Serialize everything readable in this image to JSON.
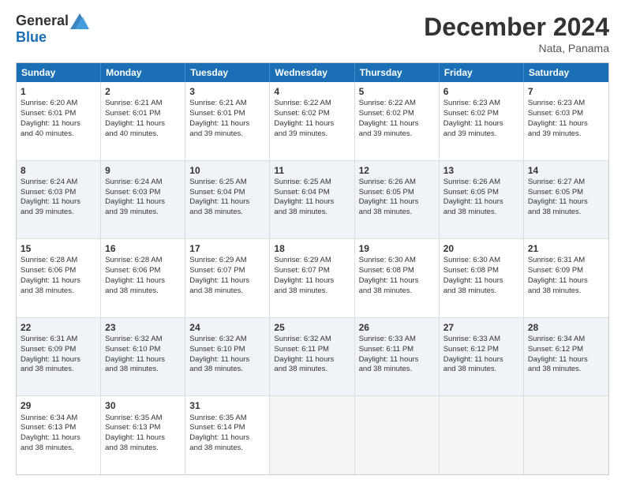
{
  "logo": {
    "general": "General",
    "blue": "Blue"
  },
  "title": "December 2024",
  "subtitle": "Nata, Panama",
  "header_days": [
    "Sunday",
    "Monday",
    "Tuesday",
    "Wednesday",
    "Thursday",
    "Friday",
    "Saturday"
  ],
  "weeks": [
    [
      {
        "day": "1",
        "lines": [
          "Sunrise: 6:20 AM",
          "Sunset: 6:01 PM",
          "Daylight: 11 hours",
          "and 40 minutes."
        ]
      },
      {
        "day": "2",
        "lines": [
          "Sunrise: 6:21 AM",
          "Sunset: 6:01 PM",
          "Daylight: 11 hours",
          "and 40 minutes."
        ]
      },
      {
        "day": "3",
        "lines": [
          "Sunrise: 6:21 AM",
          "Sunset: 6:01 PM",
          "Daylight: 11 hours",
          "and 39 minutes."
        ]
      },
      {
        "day": "4",
        "lines": [
          "Sunrise: 6:22 AM",
          "Sunset: 6:02 PM",
          "Daylight: 11 hours",
          "and 39 minutes."
        ]
      },
      {
        "day": "5",
        "lines": [
          "Sunrise: 6:22 AM",
          "Sunset: 6:02 PM",
          "Daylight: 11 hours",
          "and 39 minutes."
        ]
      },
      {
        "day": "6",
        "lines": [
          "Sunrise: 6:23 AM",
          "Sunset: 6:02 PM",
          "Daylight: 11 hours",
          "and 39 minutes."
        ]
      },
      {
        "day": "7",
        "lines": [
          "Sunrise: 6:23 AM",
          "Sunset: 6:03 PM",
          "Daylight: 11 hours",
          "and 39 minutes."
        ]
      }
    ],
    [
      {
        "day": "8",
        "lines": [
          "Sunrise: 6:24 AM",
          "Sunset: 6:03 PM",
          "Daylight: 11 hours",
          "and 39 minutes."
        ]
      },
      {
        "day": "9",
        "lines": [
          "Sunrise: 6:24 AM",
          "Sunset: 6:03 PM",
          "Daylight: 11 hours",
          "and 39 minutes."
        ]
      },
      {
        "day": "10",
        "lines": [
          "Sunrise: 6:25 AM",
          "Sunset: 6:04 PM",
          "Daylight: 11 hours",
          "and 38 minutes."
        ]
      },
      {
        "day": "11",
        "lines": [
          "Sunrise: 6:25 AM",
          "Sunset: 6:04 PM",
          "Daylight: 11 hours",
          "and 38 minutes."
        ]
      },
      {
        "day": "12",
        "lines": [
          "Sunrise: 6:26 AM",
          "Sunset: 6:05 PM",
          "Daylight: 11 hours",
          "and 38 minutes."
        ]
      },
      {
        "day": "13",
        "lines": [
          "Sunrise: 6:26 AM",
          "Sunset: 6:05 PM",
          "Daylight: 11 hours",
          "and 38 minutes."
        ]
      },
      {
        "day": "14",
        "lines": [
          "Sunrise: 6:27 AM",
          "Sunset: 6:05 PM",
          "Daylight: 11 hours",
          "and 38 minutes."
        ]
      }
    ],
    [
      {
        "day": "15",
        "lines": [
          "Sunrise: 6:28 AM",
          "Sunset: 6:06 PM",
          "Daylight: 11 hours",
          "and 38 minutes."
        ]
      },
      {
        "day": "16",
        "lines": [
          "Sunrise: 6:28 AM",
          "Sunset: 6:06 PM",
          "Daylight: 11 hours",
          "and 38 minutes."
        ]
      },
      {
        "day": "17",
        "lines": [
          "Sunrise: 6:29 AM",
          "Sunset: 6:07 PM",
          "Daylight: 11 hours",
          "and 38 minutes."
        ]
      },
      {
        "day": "18",
        "lines": [
          "Sunrise: 6:29 AM",
          "Sunset: 6:07 PM",
          "Daylight: 11 hours",
          "and 38 minutes."
        ]
      },
      {
        "day": "19",
        "lines": [
          "Sunrise: 6:30 AM",
          "Sunset: 6:08 PM",
          "Daylight: 11 hours",
          "and 38 minutes."
        ]
      },
      {
        "day": "20",
        "lines": [
          "Sunrise: 6:30 AM",
          "Sunset: 6:08 PM",
          "Daylight: 11 hours",
          "and 38 minutes."
        ]
      },
      {
        "day": "21",
        "lines": [
          "Sunrise: 6:31 AM",
          "Sunset: 6:09 PM",
          "Daylight: 11 hours",
          "and 38 minutes."
        ]
      }
    ],
    [
      {
        "day": "22",
        "lines": [
          "Sunrise: 6:31 AM",
          "Sunset: 6:09 PM",
          "Daylight: 11 hours",
          "and 38 minutes."
        ]
      },
      {
        "day": "23",
        "lines": [
          "Sunrise: 6:32 AM",
          "Sunset: 6:10 PM",
          "Daylight: 11 hours",
          "and 38 minutes."
        ]
      },
      {
        "day": "24",
        "lines": [
          "Sunrise: 6:32 AM",
          "Sunset: 6:10 PM",
          "Daylight: 11 hours",
          "and 38 minutes."
        ]
      },
      {
        "day": "25",
        "lines": [
          "Sunrise: 6:32 AM",
          "Sunset: 6:11 PM",
          "Daylight: 11 hours",
          "and 38 minutes."
        ]
      },
      {
        "day": "26",
        "lines": [
          "Sunrise: 6:33 AM",
          "Sunset: 6:11 PM",
          "Daylight: 11 hours",
          "and 38 minutes."
        ]
      },
      {
        "day": "27",
        "lines": [
          "Sunrise: 6:33 AM",
          "Sunset: 6:12 PM",
          "Daylight: 11 hours",
          "and 38 minutes."
        ]
      },
      {
        "day": "28",
        "lines": [
          "Sunrise: 6:34 AM",
          "Sunset: 6:12 PM",
          "Daylight: 11 hours",
          "and 38 minutes."
        ]
      }
    ],
    [
      {
        "day": "29",
        "lines": [
          "Sunrise: 6:34 AM",
          "Sunset: 6:13 PM",
          "Daylight: 11 hours",
          "and 38 minutes."
        ]
      },
      {
        "day": "30",
        "lines": [
          "Sunrise: 6:35 AM",
          "Sunset: 6:13 PM",
          "Daylight: 11 hours",
          "and 38 minutes."
        ]
      },
      {
        "day": "31",
        "lines": [
          "Sunrise: 6:35 AM",
          "Sunset: 6:14 PM",
          "Daylight: 11 hours",
          "and 38 minutes."
        ]
      },
      {
        "day": "",
        "lines": []
      },
      {
        "day": "",
        "lines": []
      },
      {
        "day": "",
        "lines": []
      },
      {
        "day": "",
        "lines": []
      }
    ]
  ],
  "row_alt": [
    false,
    true,
    false,
    true,
    false
  ]
}
